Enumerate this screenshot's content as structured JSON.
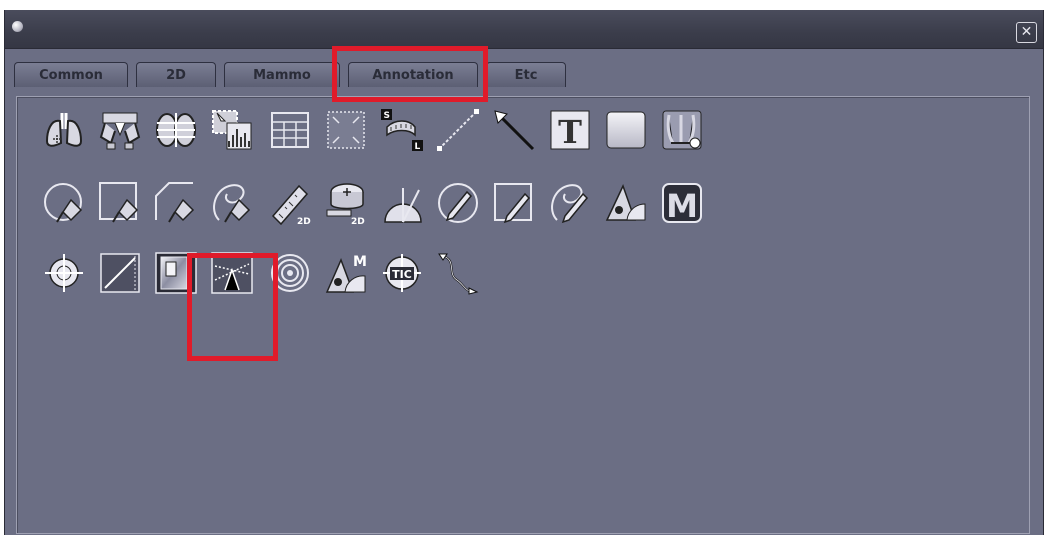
{
  "window": {
    "close_label": "✕"
  },
  "tabs": [
    {
      "label": "Common",
      "active": false
    },
    {
      "label": "2D",
      "active": false
    },
    {
      "label": "Mammo",
      "active": false
    },
    {
      "label": "Annotation",
      "active": true
    },
    {
      "label": "Etc",
      "active": false
    }
  ],
  "tools": {
    "text_tool_label": "T",
    "marker_tool_label": "M",
    "measure_2d_label": "2D",
    "tape_2d_label": "2D",
    "size_small_label": "S",
    "size_large_label": "L",
    "tic_label": "TIC",
    "angle_m_label": "M"
  },
  "colors": {
    "window_bg": "#6b6e84",
    "highlight": "#e01b2a",
    "icon_light": "#e8e8f0"
  }
}
